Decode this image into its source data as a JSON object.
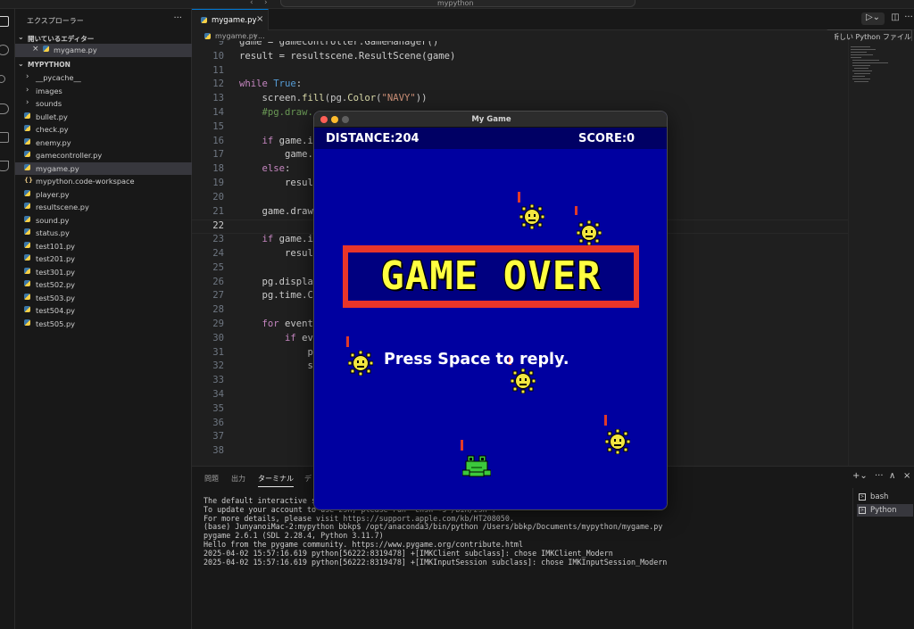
{
  "titlebar": {
    "search_text": "mypython"
  },
  "sidebar": {
    "header": "エクスプローラー",
    "open_editors_title": "開いているエディター",
    "open_editors": [
      {
        "name": "mygame.py"
      }
    ],
    "project_title": "MYPYTHON",
    "files": [
      {
        "name": "__pycache__",
        "type": "folder"
      },
      {
        "name": "images",
        "type": "folder"
      },
      {
        "name": "sounds",
        "type": "folder"
      },
      {
        "name": "bullet.py",
        "type": "py"
      },
      {
        "name": "check.py",
        "type": "py"
      },
      {
        "name": "enemy.py",
        "type": "py"
      },
      {
        "name": "gamecontroller.py",
        "type": "py"
      },
      {
        "name": "mygame.py",
        "type": "py",
        "active": true
      },
      {
        "name": "mypython.code-workspace",
        "type": "workspace"
      },
      {
        "name": "player.py",
        "type": "py"
      },
      {
        "name": "resultscene.py",
        "type": "py"
      },
      {
        "name": "sound.py",
        "type": "py"
      },
      {
        "name": "status.py",
        "type": "py"
      },
      {
        "name": "test101.py",
        "type": "py"
      },
      {
        "name": "test201.py",
        "type": "py"
      },
      {
        "name": "test301.py",
        "type": "py"
      },
      {
        "name": "test502.py",
        "type": "py"
      },
      {
        "name": "test503.py",
        "type": "py"
      },
      {
        "name": "test504.py",
        "type": "py"
      },
      {
        "name": "test505.py",
        "type": "py"
      }
    ]
  },
  "editor": {
    "tab_label": "mygame.py",
    "breadcrumb": [
      "mygame.py",
      "..."
    ],
    "tooltip": "新しい Python ファイル",
    "lines": [
      {
        "n": "9",
        "html": "game = gamecontroller.GameManager()"
      },
      {
        "n": "10",
        "html": "result = resultscene.ResultScene(game)"
      },
      {
        "n": "11",
        "html": ""
      },
      {
        "n": "12",
        "html": "<span class='k'>while</span> <span class='b'>True</span>:"
      },
      {
        "n": "13",
        "html": "    screen.<span class='f'>fill</span>(pg.<span class='f'>Color</span>(<span class='s'>\"NAVY\"</span>))"
      },
      {
        "n": "14",
        "html": "    <span class='c'>#pg.draw.</span>"
      },
      {
        "n": "15",
        "html": ""
      },
      {
        "n": "16",
        "html": "    <span class='k'>if</span> game.i"
      },
      {
        "n": "17",
        "html": "        game."
      },
      {
        "n": "18",
        "html": "    <span class='k'>else</span>:"
      },
      {
        "n": "19",
        "html": "        resul"
      },
      {
        "n": "20",
        "html": ""
      },
      {
        "n": "21",
        "html": "    game.draw"
      },
      {
        "n": "22",
        "html": "",
        "current": true
      },
      {
        "n": "23",
        "html": "    <span class='k'>if</span> game.i"
      },
      {
        "n": "24",
        "html": "        resul"
      },
      {
        "n": "25",
        "html": ""
      },
      {
        "n": "26",
        "html": "    pg.displa"
      },
      {
        "n": "27",
        "html": "    pg.time.C"
      },
      {
        "n": "28",
        "html": ""
      },
      {
        "n": "29",
        "html": "    <span class='k'>for</span> event"
      },
      {
        "n": "30",
        "html": "        <span class='k'>if</span> ev"
      },
      {
        "n": "31",
        "html": "            p"
      },
      {
        "n": "32",
        "html": "            s"
      },
      {
        "n": "33",
        "html": ""
      },
      {
        "n": "34",
        "html": ""
      },
      {
        "n": "35",
        "html": ""
      },
      {
        "n": "36",
        "html": ""
      },
      {
        "n": "37",
        "html": ""
      },
      {
        "n": "38",
        "html": ""
      }
    ]
  },
  "panel": {
    "tabs": [
      "問題",
      "出力",
      "ターミナル",
      "デ"
    ],
    "active_tab": "ターミナル",
    "terminal_lines": [
      "The default interactive she",
      "To update your account to use zsh, please run `chsh -s /bin/zsh`.",
      "For more details, please visit https://support.apple.com/kb/HT208050.",
      "(base) JunyanoiMac-2:mypython bbkp$ /opt/anaconda3/bin/python /Users/bbkp/Documents/mypython/mygame.py",
      "pygame 2.6.1 (SDL 2.28.4, Python 3.11.7)",
      "Hello from the pygame community. https://www.pygame.org/contribute.html",
      "2025-04-02 15:57:16.619 python[56222:8319478] +[IMKClient subclass]: chose IMKClient_Modern",
      "2025-04-02 15:57:16.619 python[56222:8319478] +[IMKInputSession subclass]: chose IMKInputSession_Modern"
    ],
    "terminals": [
      {
        "name": "bash",
        "active": false
      },
      {
        "name": "Python",
        "active": true
      }
    ]
  },
  "game": {
    "window_title": "My Game",
    "distance_label": "DISTANCE:204",
    "score_label": "SCORE:0",
    "gameover_text": "GAME OVER",
    "prompt": "Press Space to reply.",
    "colors": {
      "background": "#0000a0",
      "banner": "#e8352a",
      "gameover_text": "#ffff40",
      "sun": "#f2e640",
      "frog": "#3cc83c"
    }
  }
}
